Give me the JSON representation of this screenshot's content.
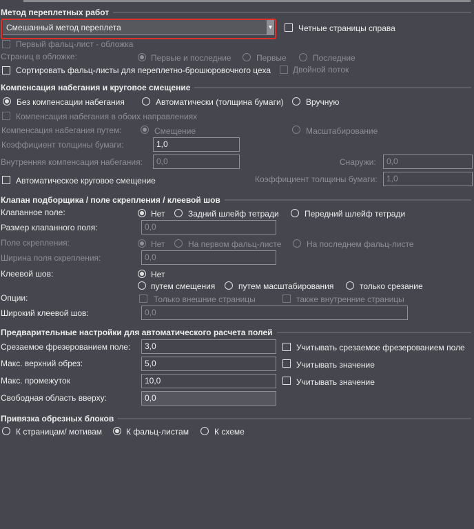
{
  "binding_method": {
    "title": "Метод переплетных работ",
    "dropdown_value": "Смешанный метод переплета",
    "even_pages_right": "Четные страницы справа",
    "first_sheet_cover": "Первый фальц-лист - обложка",
    "cover_pages_label": "Страниц в обложке:",
    "cover_options": [
      "Первые и последние",
      "Первые",
      "Последние"
    ],
    "sort_sheets": "Сортировать фальц-листы для переплетно-брошюровочного цеха",
    "double_stream": "Двойной поток"
  },
  "creep": {
    "title": "Компенсация набегания и круговое смещение",
    "modes": [
      "Без компенсации набегания",
      "Автоматически (толщина бумаги)",
      "Вручную"
    ],
    "both_directions": "Компенсация набегания в обоих направлениях",
    "method_label": "Компенсация набегания путем:",
    "method_options": [
      "Смещение",
      "Масштабирование"
    ],
    "paper_factor_label": "Коэффициент толщины бумаги:",
    "paper_factor_value": "1,0",
    "inner_label": "Внутренняя компенсация набегания:",
    "inner_value": "0,0",
    "outer_label": "Снаружи:",
    "outer_value": "0,0",
    "auto_shift": "Автоматическое круговое смещение",
    "paper_factor2_label": "Коэффициент толщины бумаги:",
    "paper_factor2_value": "1,0"
  },
  "lip": {
    "title": "Клапан подборщика / поле скрепления / клеевой шов",
    "lip_label": "Клапанное поле:",
    "lip_options": [
      "Нет",
      "Задний шлейф тетради",
      "Передний шлейф тетради"
    ],
    "lip_size_label": "Размер клапанного поля:",
    "lip_size_value": "0,0",
    "binding_field_label": "Поле скрепления:",
    "binding_field_options": [
      "Нет",
      "На первом фальц-листе",
      "На последнем фальц-листе"
    ],
    "binding_width_label": "Ширина поля скрепления:",
    "binding_width_value": "0,0",
    "glue_label": "Клеевой шов:",
    "glue_options": [
      "Нет",
      "путем смещения",
      "путем масштабирования",
      "только срезание"
    ],
    "options_label": "Опции:",
    "option_outer": "Только внешние страницы",
    "option_inner": "также внутренние страницы",
    "wide_glue_label": "Широкий клеевой шов:",
    "wide_glue_value": "0,0"
  },
  "presets": {
    "title": "Предварительные настройки для автоматического расчета полей",
    "milling_label": "Срезаемое фрезерованием поле:",
    "milling_value": "3,0",
    "milling_check": "Учитывать срезаемое фрезерованием поле",
    "top_trim_label": "Макс. верхний обрез:",
    "top_trim_value": "5,0",
    "top_trim_check": "Учитывать значение",
    "gap_label": "Макс. промежуток",
    "gap_value": "10,0",
    "gap_check": "Учитывать значение",
    "free_top_label": "Свободная область вверху:",
    "free_top_value": "0,0"
  },
  "anchor": {
    "title": "Привязка обрезных блоков",
    "options": [
      "К страницам/ мотивам",
      "К фальц-листам",
      "К схеме"
    ]
  }
}
